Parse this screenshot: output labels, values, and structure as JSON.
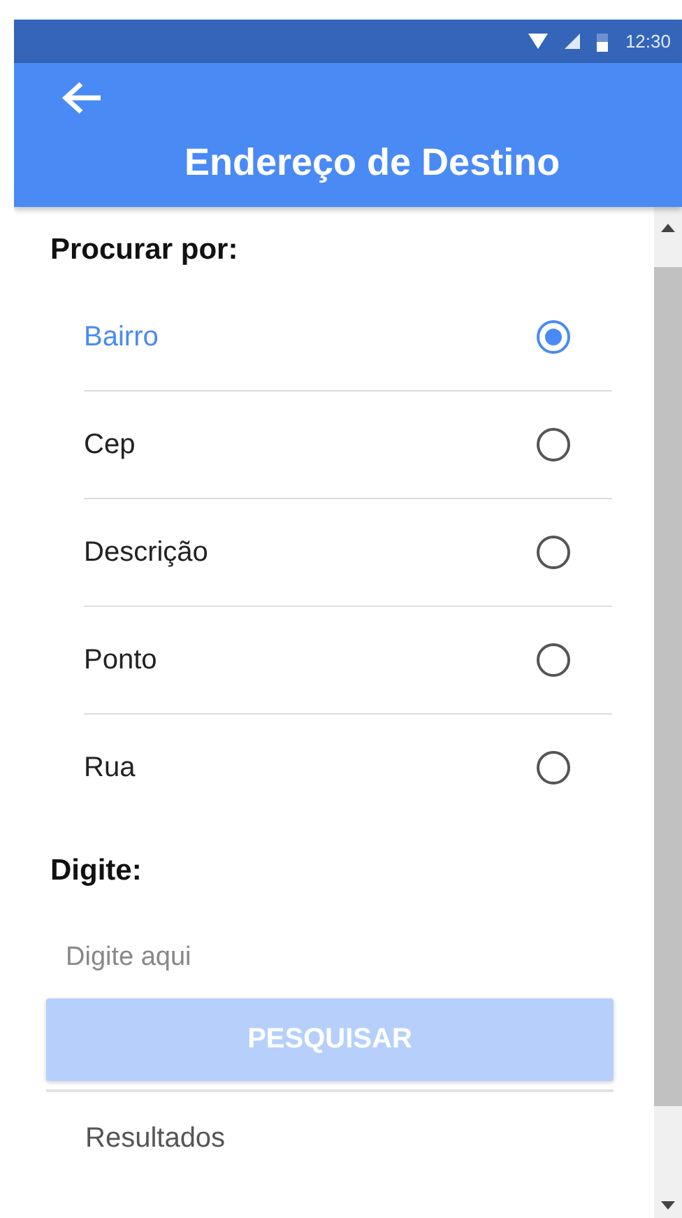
{
  "status_bar": {
    "time": "12:30"
  },
  "app_bar": {
    "title": "Endereço de Destino"
  },
  "search_by": {
    "label": "Procurar por:",
    "options": [
      {
        "label": "Bairro",
        "selected": true
      },
      {
        "label": "Cep",
        "selected": false
      },
      {
        "label": "Descrição",
        "selected": false
      },
      {
        "label": "Ponto",
        "selected": false
      },
      {
        "label": "Rua",
        "selected": false
      }
    ]
  },
  "input": {
    "label": "Digite:",
    "placeholder": "Digite aqui"
  },
  "search_button": {
    "label": "PESQUISAR",
    "disabled": true
  },
  "results": {
    "label": "Resultados"
  }
}
